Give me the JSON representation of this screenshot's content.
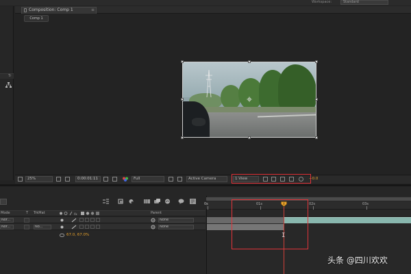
{
  "workspace": {
    "label": "Workspace:",
    "value": "Standard"
  },
  "left_panel": {
    "tab_label": "Tr"
  },
  "composition_panel": {
    "tab_label": "Composition: Comp 1",
    "breadcrumb": "Comp 1"
  },
  "comp_toolbar": {
    "zoom": "25%",
    "timecode": "0:00:01:11",
    "resolution": "Full",
    "camera": "Active Camera",
    "views": "1 View",
    "exposure": "+0.0"
  },
  "timeline": {
    "columns": {
      "mode": "Mode",
      "t": "T",
      "trkmat": "TrkMat",
      "parent": "Parent"
    },
    "layers": [
      {
        "mode": "Nor...",
        "trkmat": "",
        "parent": "None"
      },
      {
        "mode": "Nor...",
        "trkmat": "No...",
        "parent": "None"
      }
    ],
    "scale_value": "67.0, 67.0%",
    "ruler": {
      "start": "0s",
      "labels": [
        "01s",
        "02s",
        "03s"
      ]
    }
  },
  "watermark": "头条 @四川欢欢",
  "colors": {
    "highlight": "#e4343a",
    "playhead": "#d2413a",
    "accent_value": "#e7a22c",
    "layer_bar": "#89b7ae"
  }
}
